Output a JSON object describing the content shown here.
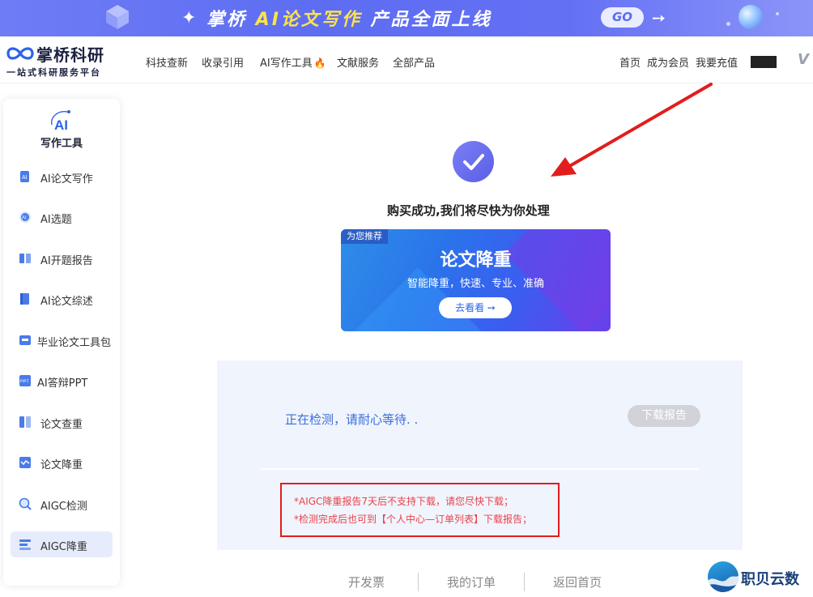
{
  "banner": {
    "text_prefix": "掌桥 ",
    "text_highlight": "AI论文写作",
    "text_suffix": " 产品全面上线",
    "go_label": "GO",
    "arrow_glyph": "➙"
  },
  "header": {
    "logo_name": "掌桥科研",
    "logo_slogan": "一站式科研服务平台",
    "nav": [
      "科技查新",
      "收录引用",
      "AI写作工具",
      "文献服务",
      "全部产品"
    ],
    "right_nav": [
      "首页",
      "成为会员",
      "我要充值"
    ]
  },
  "sidebar": {
    "title": "写作工具",
    "items": [
      {
        "label": "AI论文写作",
        "icon": "ai-paper-icon"
      },
      {
        "label": "AI选题",
        "icon": "ai-topic-icon"
      },
      {
        "label": "AI开题报告",
        "icon": "proposal-report-icon"
      },
      {
        "label": "AI论文综述",
        "icon": "review-icon"
      },
      {
        "label": "毕业论文工具包",
        "icon": "toolkit-icon"
      },
      {
        "label": "AI答辩PPT",
        "icon": "ppt-icon"
      },
      {
        "label": "论文查重",
        "icon": "plagiarism-check-icon"
      },
      {
        "label": "论文降重",
        "icon": "rewrite-icon"
      },
      {
        "label": "AIGC检测",
        "icon": "aigc-detect-icon"
      },
      {
        "label": "AIGC降重",
        "icon": "aigc-reduce-icon"
      }
    ],
    "active_index": 9
  },
  "main": {
    "success_message": "购买成功,我们将尽快为你处理",
    "promo": {
      "tag": "为您推荐",
      "title": "论文降重",
      "subtitle": "智能降重，快速、专业、准确",
      "button_label": "去看看 ➙"
    },
    "status_text": "正在检测，请耐心等待. .",
    "download_label": "下载报告",
    "notes": [
      "*AIGC降重报告7天后不支持下载，请您尽快下载；",
      "*检测完成后也可到【个人中心—订单列表】下载报告；"
    ],
    "footer_links": [
      "开发票",
      "我的订单",
      "返回首页"
    ]
  },
  "watermark": {
    "text": "职贝云数"
  },
  "colors": {
    "accent": "#5b6cf0",
    "status_blue": "#3c6ed8",
    "note_red": "#e8434b",
    "annotation_red": "#e21d1d"
  }
}
